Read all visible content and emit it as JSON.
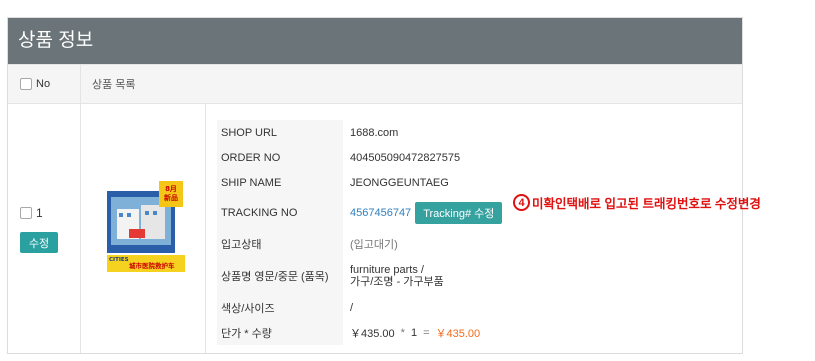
{
  "header": {
    "title": "상품 정보"
  },
  "table": {
    "col_no": "No",
    "col_list": "상품 목록"
  },
  "row": {
    "index": "1",
    "edit_label": "수정",
    "product_image": {
      "badge_top": "8月",
      "badge_mid": "新品",
      "brand": "CITIES",
      "caption": "城市医院救护车"
    },
    "fields": {
      "shop_url_label": "SHOP URL",
      "shop_url": "1688.com",
      "order_no_label": "ORDER NO",
      "order_no": "404505090472827575",
      "ship_name_label": "SHIP NAME",
      "ship_name": "JEONGGEUNTAEG",
      "tracking_no_label": "TRACKING NO",
      "tracking_no": "4567456747",
      "tracking_button": "Tracking# 수정",
      "annotation_number": "4",
      "annotation_text": "미확인택배로 입고된 트래킹번호로 수정변경",
      "status_label": "입고상태",
      "status_value": "(입고대기)",
      "product_name_label": "상품명 영문/중문 (품목)",
      "product_name_line1": "furniture parts /",
      "product_name_line2": "가구/조명 - 가구부품",
      "color_size_label": "색상/사이즈",
      "color_size_value": "/",
      "price_qty_label": "단가 * 수량",
      "unit_price": "￥435.00",
      "times": "*",
      "quantity": "1",
      "equals": "=",
      "total": "￥435.00"
    }
  },
  "colors": {
    "header_bg": "#6b7479",
    "accent_teal": "#2aa0a0",
    "link_blue": "#2f7fbf",
    "price_orange": "#f26a1b",
    "annotation_red": "#e01010"
  }
}
